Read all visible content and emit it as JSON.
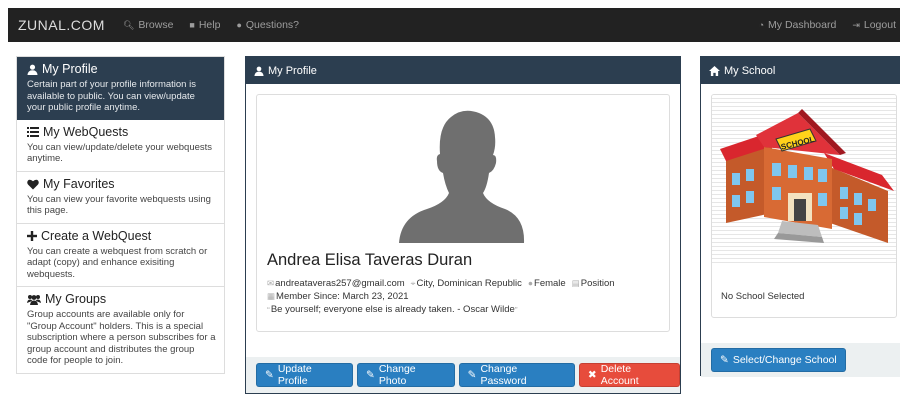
{
  "navbar": {
    "brand": "ZUNAL.COM",
    "links": [
      {
        "label": "Browse",
        "icon": "search-icon"
      },
      {
        "label": "Help",
        "icon": "book-icon"
      },
      {
        "label": "Questions?",
        "icon": "comments-icon"
      }
    ],
    "right_links": [
      {
        "label": "My Dashboard",
        "icon": "dashboard-icon"
      },
      {
        "label": "Logout",
        "icon": "logout-icon"
      }
    ]
  },
  "sidebar": {
    "items": [
      {
        "title": "My Profile",
        "desc": "Certain part of your profile information is available to public. You can view/update your public profile anytime.",
        "icon": "user-icon"
      },
      {
        "title": "My WebQuests",
        "desc": "You can view/update/delete your webquests anytime.",
        "icon": "list-icon"
      },
      {
        "title": "My Favorites",
        "desc": "You can view your favorite webquests using this page.",
        "icon": "heart-icon"
      },
      {
        "title": "Create a WebQuest",
        "desc": "You can create a webquest from scratch or adapt (copy) and enhance exisiting webquests.",
        "icon": "plus-icon"
      },
      {
        "title": "My Groups",
        "desc": "Group accounts are available only for \"Group Account\" holders. This is a special subscription where a person subscribes for a group account and distributes the group code for people to join.",
        "icon": "users-icon"
      }
    ]
  },
  "profile_panel": {
    "title": "My Profile",
    "name": "Andrea Elisa Taveras Duran",
    "email": "andreataveras257@gmail.com",
    "location": "City, Dominican Republic",
    "gender": "Female",
    "position": "Position",
    "member_since": "Member Since: March 23, 2021",
    "quote": "Be yourself; everyone else is already taken. - Oscar Wilde",
    "buttons": {
      "update": "Update Profile",
      "photo": "Change Photo",
      "password": "Change Password",
      "delete": "Delete Account"
    }
  },
  "school_panel": {
    "title": "My School",
    "status": "No School Selected",
    "sign": "SCHOOL",
    "button": "Select/Change School"
  },
  "colors": {
    "navbar": "#222222",
    "panel_header": "#2c3e50",
    "button_primary": "#2a7fc1",
    "button_danger": "#e74c3c"
  }
}
